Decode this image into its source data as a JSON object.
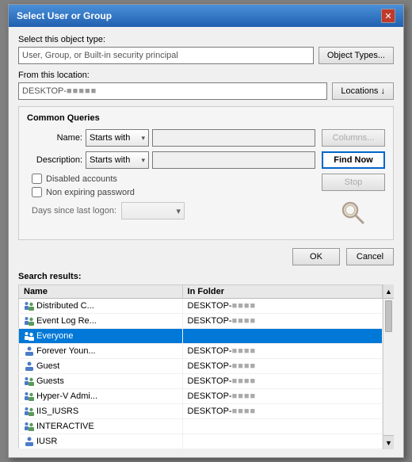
{
  "dialog": {
    "title": "Select User or Group",
    "close_label": "✕"
  },
  "object_type": {
    "label": "Select this object type:",
    "value": "User, Group, or Built-in security principal",
    "button": "Object Types..."
  },
  "location": {
    "label": "From this location:",
    "value": "DESKTOP-",
    "value_blur": "■■■■■",
    "button": "Locations ↓"
  },
  "common_queries": {
    "title": "Common Queries",
    "name_label": "Name:",
    "name_filter": "Starts with",
    "name_value": "",
    "desc_label": "Description:",
    "desc_filter": "Starts with",
    "desc_value": "",
    "disabled_accounts": "Disabled accounts",
    "non_expiring": "Non expiring password",
    "days_label": "Days since last logon:",
    "columns_btn": "Columns...",
    "find_now_btn": "Find Now",
    "stop_btn": "Stop"
  },
  "footer": {
    "ok": "OK",
    "cancel": "Cancel"
  },
  "search_results": {
    "label": "Search results:",
    "columns": [
      "Name",
      "In Folder"
    ],
    "rows": [
      {
        "name": "Distributed C...",
        "folder": "DESKTOP-",
        "type": "group"
      },
      {
        "name": "Event Log Re...",
        "folder": "DESKTOP-",
        "type": "group"
      },
      {
        "name": "Everyone",
        "folder": "",
        "type": "group_special",
        "selected": true
      },
      {
        "name": "Forever Youn...",
        "folder": "DESKTOP-",
        "type": "user"
      },
      {
        "name": "Guest",
        "folder": "DESKTOP-",
        "type": "user"
      },
      {
        "name": "Guests",
        "folder": "DESKTOP-",
        "type": "group"
      },
      {
        "name": "Hyper-V Admi...",
        "folder": "DESKTOP-",
        "type": "group"
      },
      {
        "name": "IIS_IUSRS",
        "folder": "DESKTOP-",
        "type": "group"
      },
      {
        "name": "INTERACTIVE",
        "folder": "",
        "type": "group_special"
      },
      {
        "name": "IUSR",
        "folder": "",
        "type": "user_special"
      }
    ]
  }
}
